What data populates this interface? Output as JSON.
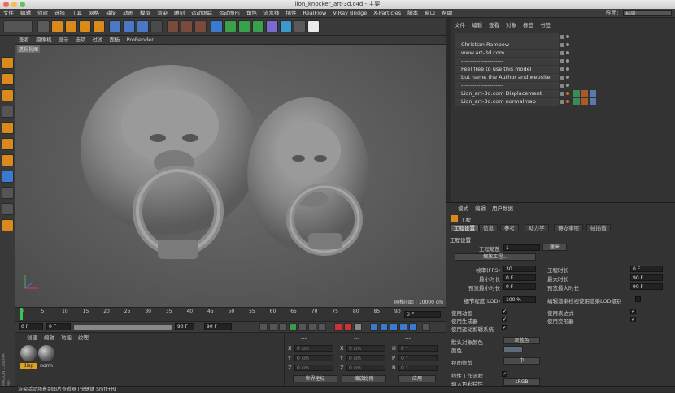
{
  "window": {
    "title": "lion_knocker_art-3d.c4d - 主要"
  },
  "menubar": {
    "items": [
      "文件",
      "编辑",
      "创建",
      "选择",
      "工具",
      "网格",
      "捕捉",
      "动画",
      "模拟",
      "渲染",
      "雕刻",
      "运动跟踪",
      "运动图形",
      "角色",
      "流水线",
      "插件",
      "RealFlow",
      "V-Ray Bridge",
      "X-Particles",
      "脚本",
      "窗口",
      "帮助"
    ],
    "layout_label": "界面:",
    "layout_value": "启动"
  },
  "viewport": {
    "menu": [
      "查看",
      "摄像机",
      "显示",
      "选项",
      "过滤",
      "面板",
      "ProRender"
    ],
    "label": "透视视图",
    "grid_info": "网格间距 : 10000 cm"
  },
  "timeline": {
    "ticks": [
      "0",
      "5",
      "10",
      "15",
      "20",
      "25",
      "30",
      "35",
      "40",
      "45",
      "50",
      "55",
      "60",
      "65",
      "70",
      "75",
      "80",
      "85",
      "90"
    ],
    "frame_display": "0 F",
    "start": "0 F",
    "current": "0 F",
    "end": "90 F",
    "end2": "90 F"
  },
  "materials": {
    "menu": [
      "创建",
      "编辑",
      "功能",
      "纹理"
    ],
    "items": [
      {
        "label": "disp"
      },
      {
        "label": "norm"
      }
    ],
    "watermark": "MAXON CINEMA 4D"
  },
  "coords": {
    "header": [
      "---",
      "---",
      "---"
    ],
    "rows": [
      {
        "axis": "X",
        "pos": "0 cm",
        "axis2": "X",
        "size": "0 cm",
        "rot_label": "H",
        "rot": "0 °"
      },
      {
        "axis": "Y",
        "pos": "0 cm",
        "axis2": "Y",
        "size": "0 cm",
        "rot_label": "P",
        "rot": "0 °"
      },
      {
        "axis": "Z",
        "pos": "0 cm",
        "axis2": "Z",
        "size": "0 cm",
        "rot_label": "B",
        "rot": "0 °"
      }
    ],
    "mode1": "世界坐标",
    "mode2": "缩放比例",
    "apply": "应用"
  },
  "objects": {
    "menu": [
      "文件",
      "编辑",
      "查看",
      "对象",
      "标签",
      "书签"
    ],
    "rows": [
      "----------------------",
      "Christian Rambow",
      "www.art-3d.com",
      "----------------------",
      "Feel free to use this model",
      "but name the Author and website",
      "----------------------",
      "Lion_art-3d.com Displacement",
      "Lion_art-3d.com normalmap"
    ]
  },
  "attributes": {
    "menu": [
      "模式",
      "编辑",
      "用户数据"
    ],
    "title": "工程",
    "tabs": [
      "工程设置",
      "信息",
      "参考",
      "动力学",
      "待办事项",
      "帧插值"
    ],
    "section": "工程设置",
    "scale_label": "工程缩放",
    "scale_value": "1",
    "scale_unit": "厘米",
    "scale_btn": "缩放工程...",
    "fps_label": "帧率(FPS)",
    "fps_value": "30",
    "proj_len_label": "工程时长",
    "proj_len_value": "0 F",
    "min_label": "最小时长",
    "min_value": "0 F",
    "max_label": "最大时长",
    "max_value": "90 F",
    "pmin_label": "预览最小时长",
    "pmin_value": "0 F",
    "pmax_label": "预览最大时长",
    "pmax_value": "90 F",
    "lod_label": "细节程度(LOD)",
    "lod_value": "100 %",
    "lod_render_label": "编辑渲染检视使用渲染LOD级别",
    "use_anim": "使用动画",
    "use_expr": "使用表达式",
    "use_gen": "使用生成器",
    "use_deform": "使用变形器",
    "use_motion": "使用运动剪辑系统",
    "default_color_label": "默认对象颜色",
    "default_color_value": "灰蓝色",
    "color_label": "颜色",
    "view_clip_label": "视图修剪",
    "view_clip_value": "中",
    "linear_label": "线性工作流程",
    "input_profile_label": "输入色彩特性",
    "input_profile_value": "sRGB",
    "check": "✓"
  },
  "status": "渲染活动场景到图片查看器 [快捷键 Shift+R]"
}
